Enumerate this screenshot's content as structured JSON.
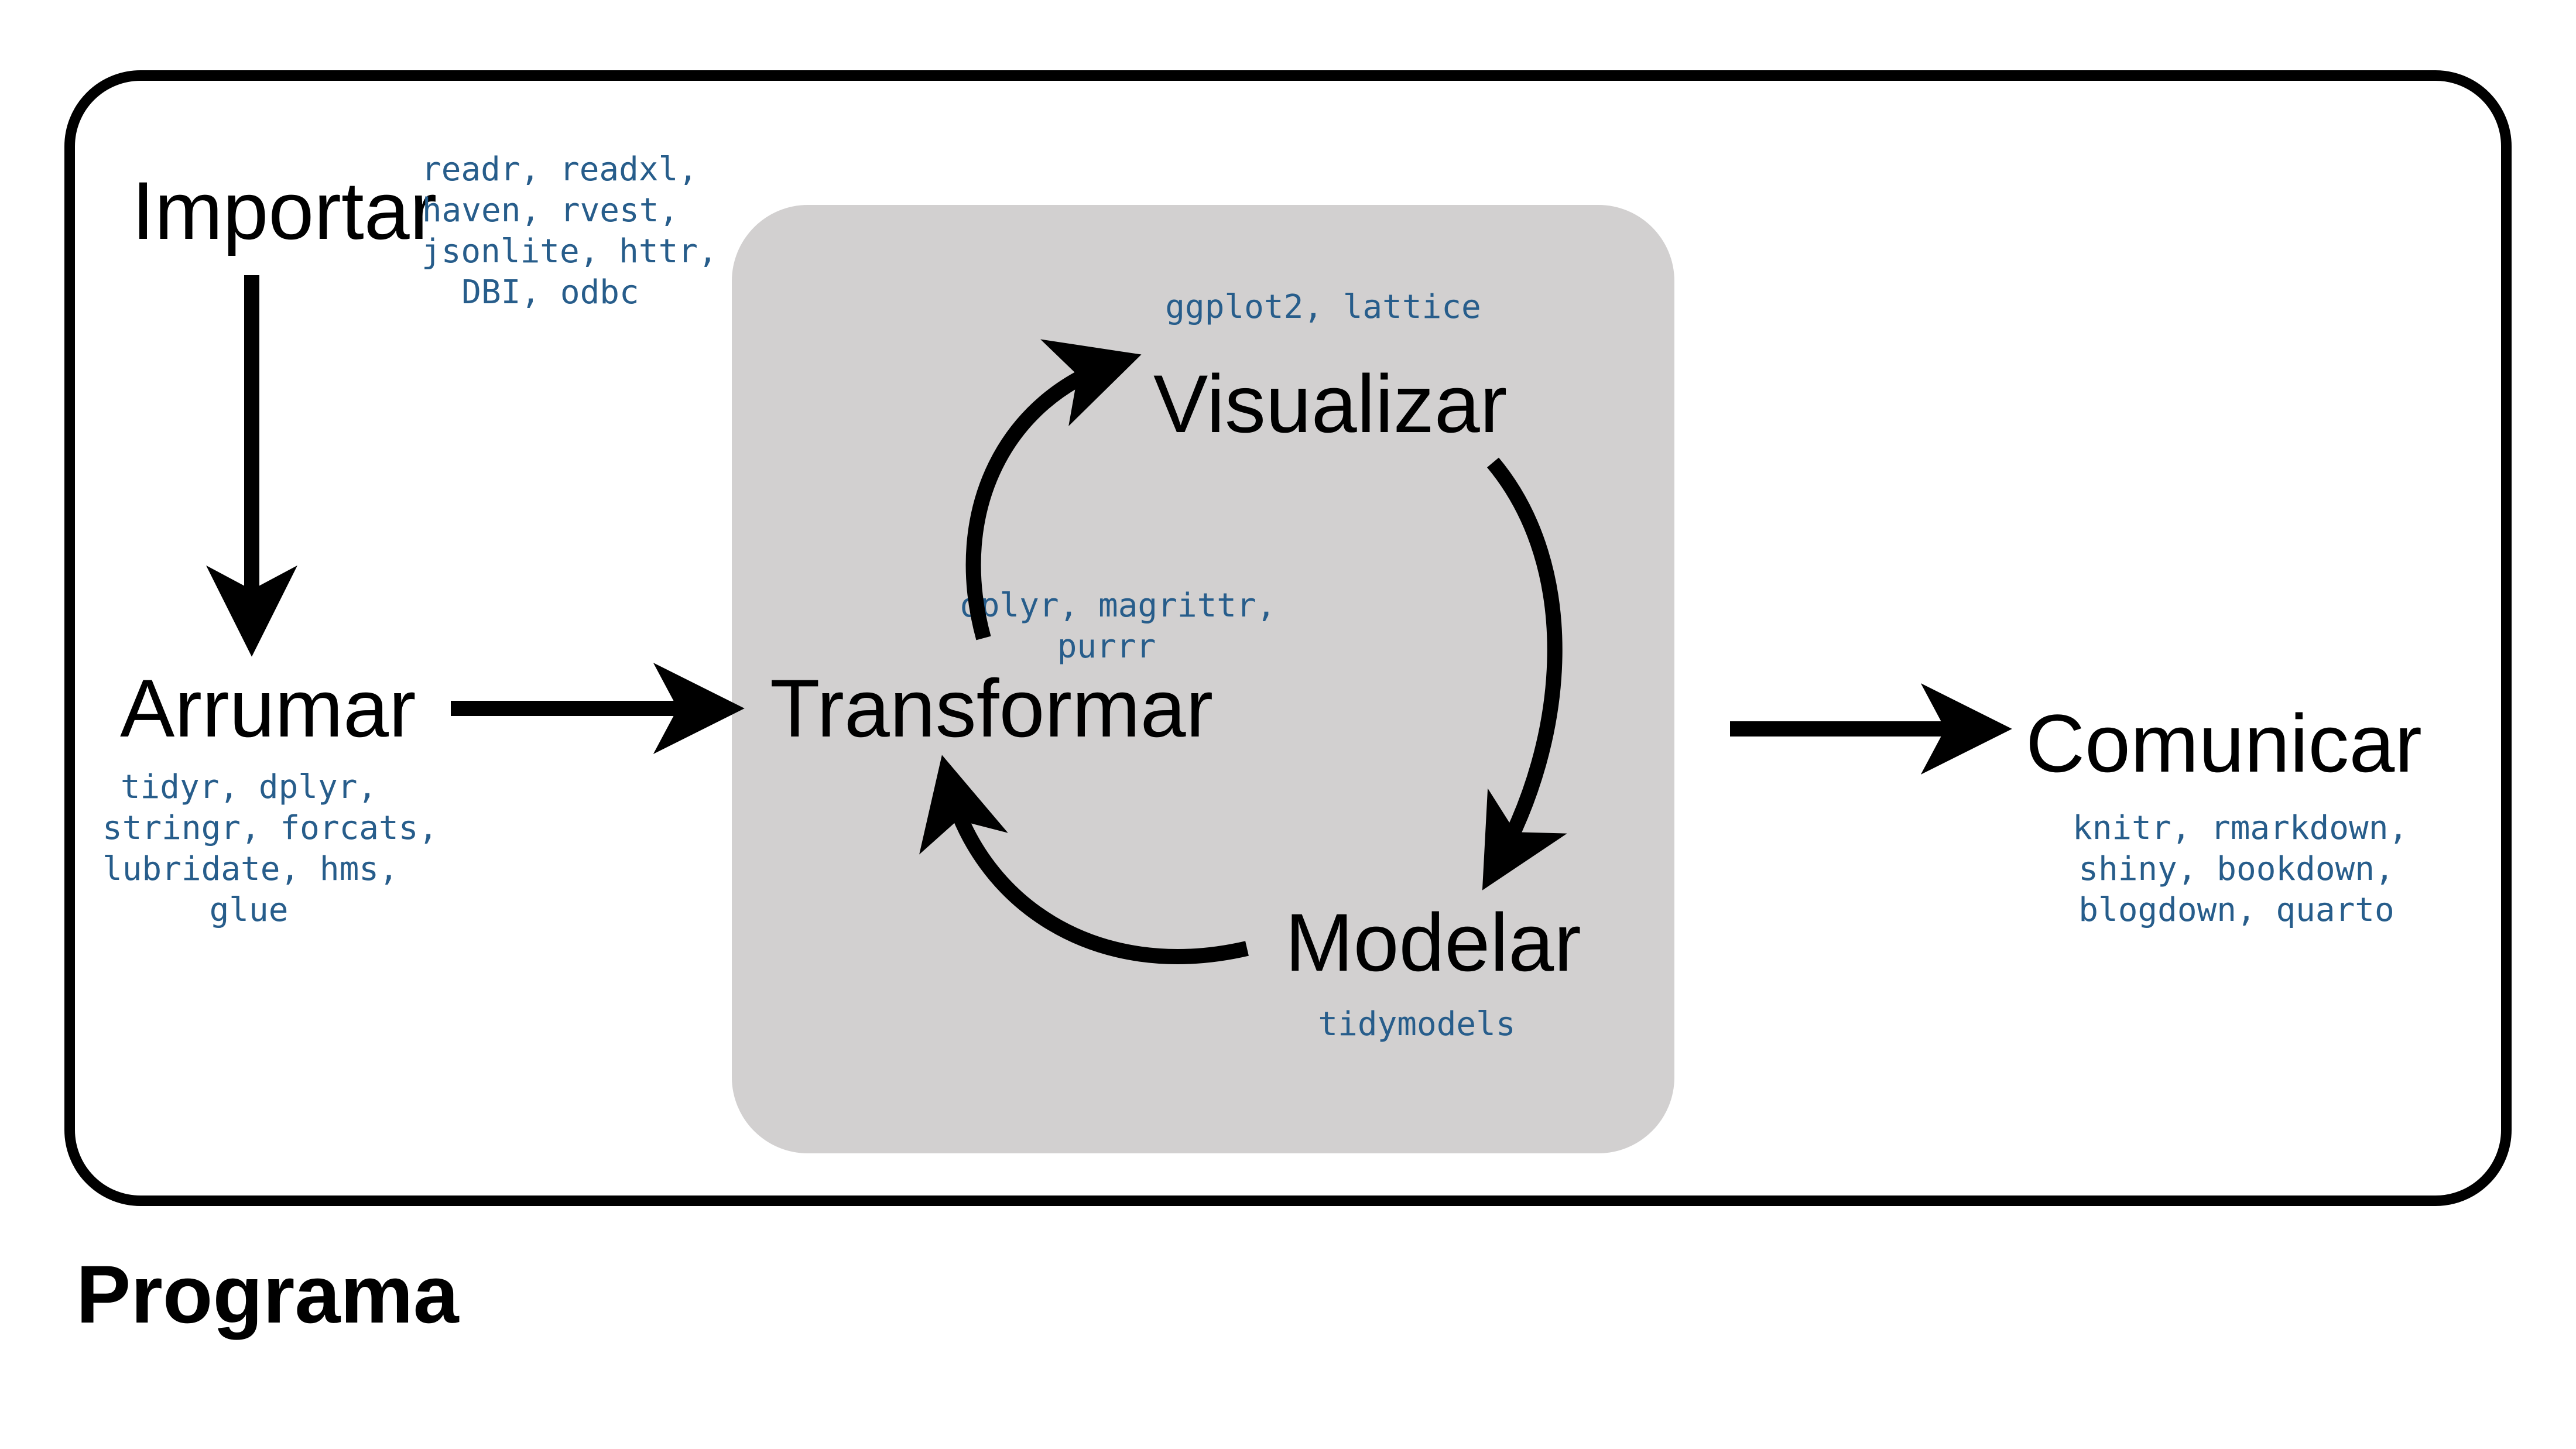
{
  "title": "Programa",
  "stages": {
    "import": {
      "label": "Importar",
      "packages": "readr, readxl,\nhaven, rvest,\njsonlite, httr,\nDBI, odbc"
    },
    "tidy": {
      "label": "Arrumar",
      "packages": "tidyr, dplyr,\nstringr, forcats,\nlubridate, hms,\nglue"
    },
    "transform": {
      "label": "Transformar",
      "packages": "dplyr, magrittr,\npurrr"
    },
    "visualize": {
      "label": "Visualizar",
      "packages": "ggplot2, lattice"
    },
    "model": {
      "label": "Modelar",
      "packages": "tidymodels"
    },
    "communicate": {
      "label": "Comunicar",
      "packages": "knitr, rmarkdown,\nshiny, bookdown,\nblogdown, quarto"
    }
  },
  "colors": {
    "package_text": "#275d8b",
    "cycle_background": "#d2d0d0",
    "stroke": "#000000"
  }
}
